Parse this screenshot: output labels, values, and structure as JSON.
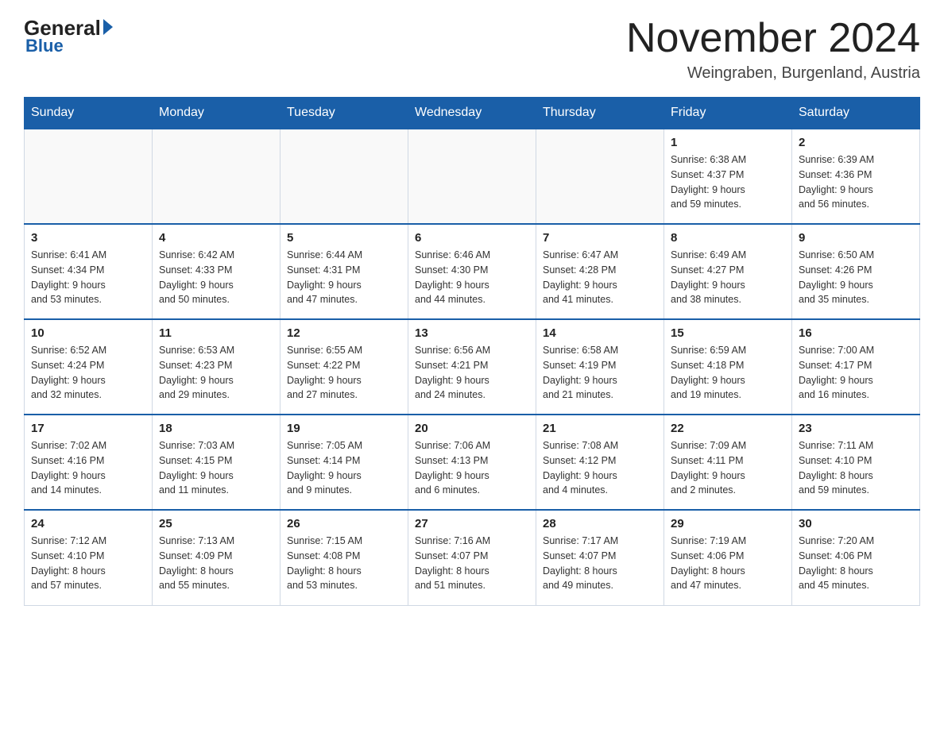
{
  "logo": {
    "general": "General",
    "blue": "Blue",
    "sub": "Blue"
  },
  "title": "November 2024",
  "subtitle": "Weingraben, Burgenland, Austria",
  "header": {
    "days": [
      "Sunday",
      "Monday",
      "Tuesday",
      "Wednesday",
      "Thursday",
      "Friday",
      "Saturday"
    ]
  },
  "weeks": [
    {
      "cells": [
        {
          "day": "",
          "info": ""
        },
        {
          "day": "",
          "info": ""
        },
        {
          "day": "",
          "info": ""
        },
        {
          "day": "",
          "info": ""
        },
        {
          "day": "",
          "info": ""
        },
        {
          "day": "1",
          "info": "Sunrise: 6:38 AM\nSunset: 4:37 PM\nDaylight: 9 hours\nand 59 minutes."
        },
        {
          "day": "2",
          "info": "Sunrise: 6:39 AM\nSunset: 4:36 PM\nDaylight: 9 hours\nand 56 minutes."
        }
      ]
    },
    {
      "cells": [
        {
          "day": "3",
          "info": "Sunrise: 6:41 AM\nSunset: 4:34 PM\nDaylight: 9 hours\nand 53 minutes."
        },
        {
          "day": "4",
          "info": "Sunrise: 6:42 AM\nSunset: 4:33 PM\nDaylight: 9 hours\nand 50 minutes."
        },
        {
          "day": "5",
          "info": "Sunrise: 6:44 AM\nSunset: 4:31 PM\nDaylight: 9 hours\nand 47 minutes."
        },
        {
          "day": "6",
          "info": "Sunrise: 6:46 AM\nSunset: 4:30 PM\nDaylight: 9 hours\nand 44 minutes."
        },
        {
          "day": "7",
          "info": "Sunrise: 6:47 AM\nSunset: 4:28 PM\nDaylight: 9 hours\nand 41 minutes."
        },
        {
          "day": "8",
          "info": "Sunrise: 6:49 AM\nSunset: 4:27 PM\nDaylight: 9 hours\nand 38 minutes."
        },
        {
          "day": "9",
          "info": "Sunrise: 6:50 AM\nSunset: 4:26 PM\nDaylight: 9 hours\nand 35 minutes."
        }
      ]
    },
    {
      "cells": [
        {
          "day": "10",
          "info": "Sunrise: 6:52 AM\nSunset: 4:24 PM\nDaylight: 9 hours\nand 32 minutes."
        },
        {
          "day": "11",
          "info": "Sunrise: 6:53 AM\nSunset: 4:23 PM\nDaylight: 9 hours\nand 29 minutes."
        },
        {
          "day": "12",
          "info": "Sunrise: 6:55 AM\nSunset: 4:22 PM\nDaylight: 9 hours\nand 27 minutes."
        },
        {
          "day": "13",
          "info": "Sunrise: 6:56 AM\nSunset: 4:21 PM\nDaylight: 9 hours\nand 24 minutes."
        },
        {
          "day": "14",
          "info": "Sunrise: 6:58 AM\nSunset: 4:19 PM\nDaylight: 9 hours\nand 21 minutes."
        },
        {
          "day": "15",
          "info": "Sunrise: 6:59 AM\nSunset: 4:18 PM\nDaylight: 9 hours\nand 19 minutes."
        },
        {
          "day": "16",
          "info": "Sunrise: 7:00 AM\nSunset: 4:17 PM\nDaylight: 9 hours\nand 16 minutes."
        }
      ]
    },
    {
      "cells": [
        {
          "day": "17",
          "info": "Sunrise: 7:02 AM\nSunset: 4:16 PM\nDaylight: 9 hours\nand 14 minutes."
        },
        {
          "day": "18",
          "info": "Sunrise: 7:03 AM\nSunset: 4:15 PM\nDaylight: 9 hours\nand 11 minutes."
        },
        {
          "day": "19",
          "info": "Sunrise: 7:05 AM\nSunset: 4:14 PM\nDaylight: 9 hours\nand 9 minutes."
        },
        {
          "day": "20",
          "info": "Sunrise: 7:06 AM\nSunset: 4:13 PM\nDaylight: 9 hours\nand 6 minutes."
        },
        {
          "day": "21",
          "info": "Sunrise: 7:08 AM\nSunset: 4:12 PM\nDaylight: 9 hours\nand 4 minutes."
        },
        {
          "day": "22",
          "info": "Sunrise: 7:09 AM\nSunset: 4:11 PM\nDaylight: 9 hours\nand 2 minutes."
        },
        {
          "day": "23",
          "info": "Sunrise: 7:11 AM\nSunset: 4:10 PM\nDaylight: 8 hours\nand 59 minutes."
        }
      ]
    },
    {
      "cells": [
        {
          "day": "24",
          "info": "Sunrise: 7:12 AM\nSunset: 4:10 PM\nDaylight: 8 hours\nand 57 minutes."
        },
        {
          "day": "25",
          "info": "Sunrise: 7:13 AM\nSunset: 4:09 PM\nDaylight: 8 hours\nand 55 minutes."
        },
        {
          "day": "26",
          "info": "Sunrise: 7:15 AM\nSunset: 4:08 PM\nDaylight: 8 hours\nand 53 minutes."
        },
        {
          "day": "27",
          "info": "Sunrise: 7:16 AM\nSunset: 4:07 PM\nDaylight: 8 hours\nand 51 minutes."
        },
        {
          "day": "28",
          "info": "Sunrise: 7:17 AM\nSunset: 4:07 PM\nDaylight: 8 hours\nand 49 minutes."
        },
        {
          "day": "29",
          "info": "Sunrise: 7:19 AM\nSunset: 4:06 PM\nDaylight: 8 hours\nand 47 minutes."
        },
        {
          "day": "30",
          "info": "Sunrise: 7:20 AM\nSunset: 4:06 PM\nDaylight: 8 hours\nand 45 minutes."
        }
      ]
    }
  ]
}
